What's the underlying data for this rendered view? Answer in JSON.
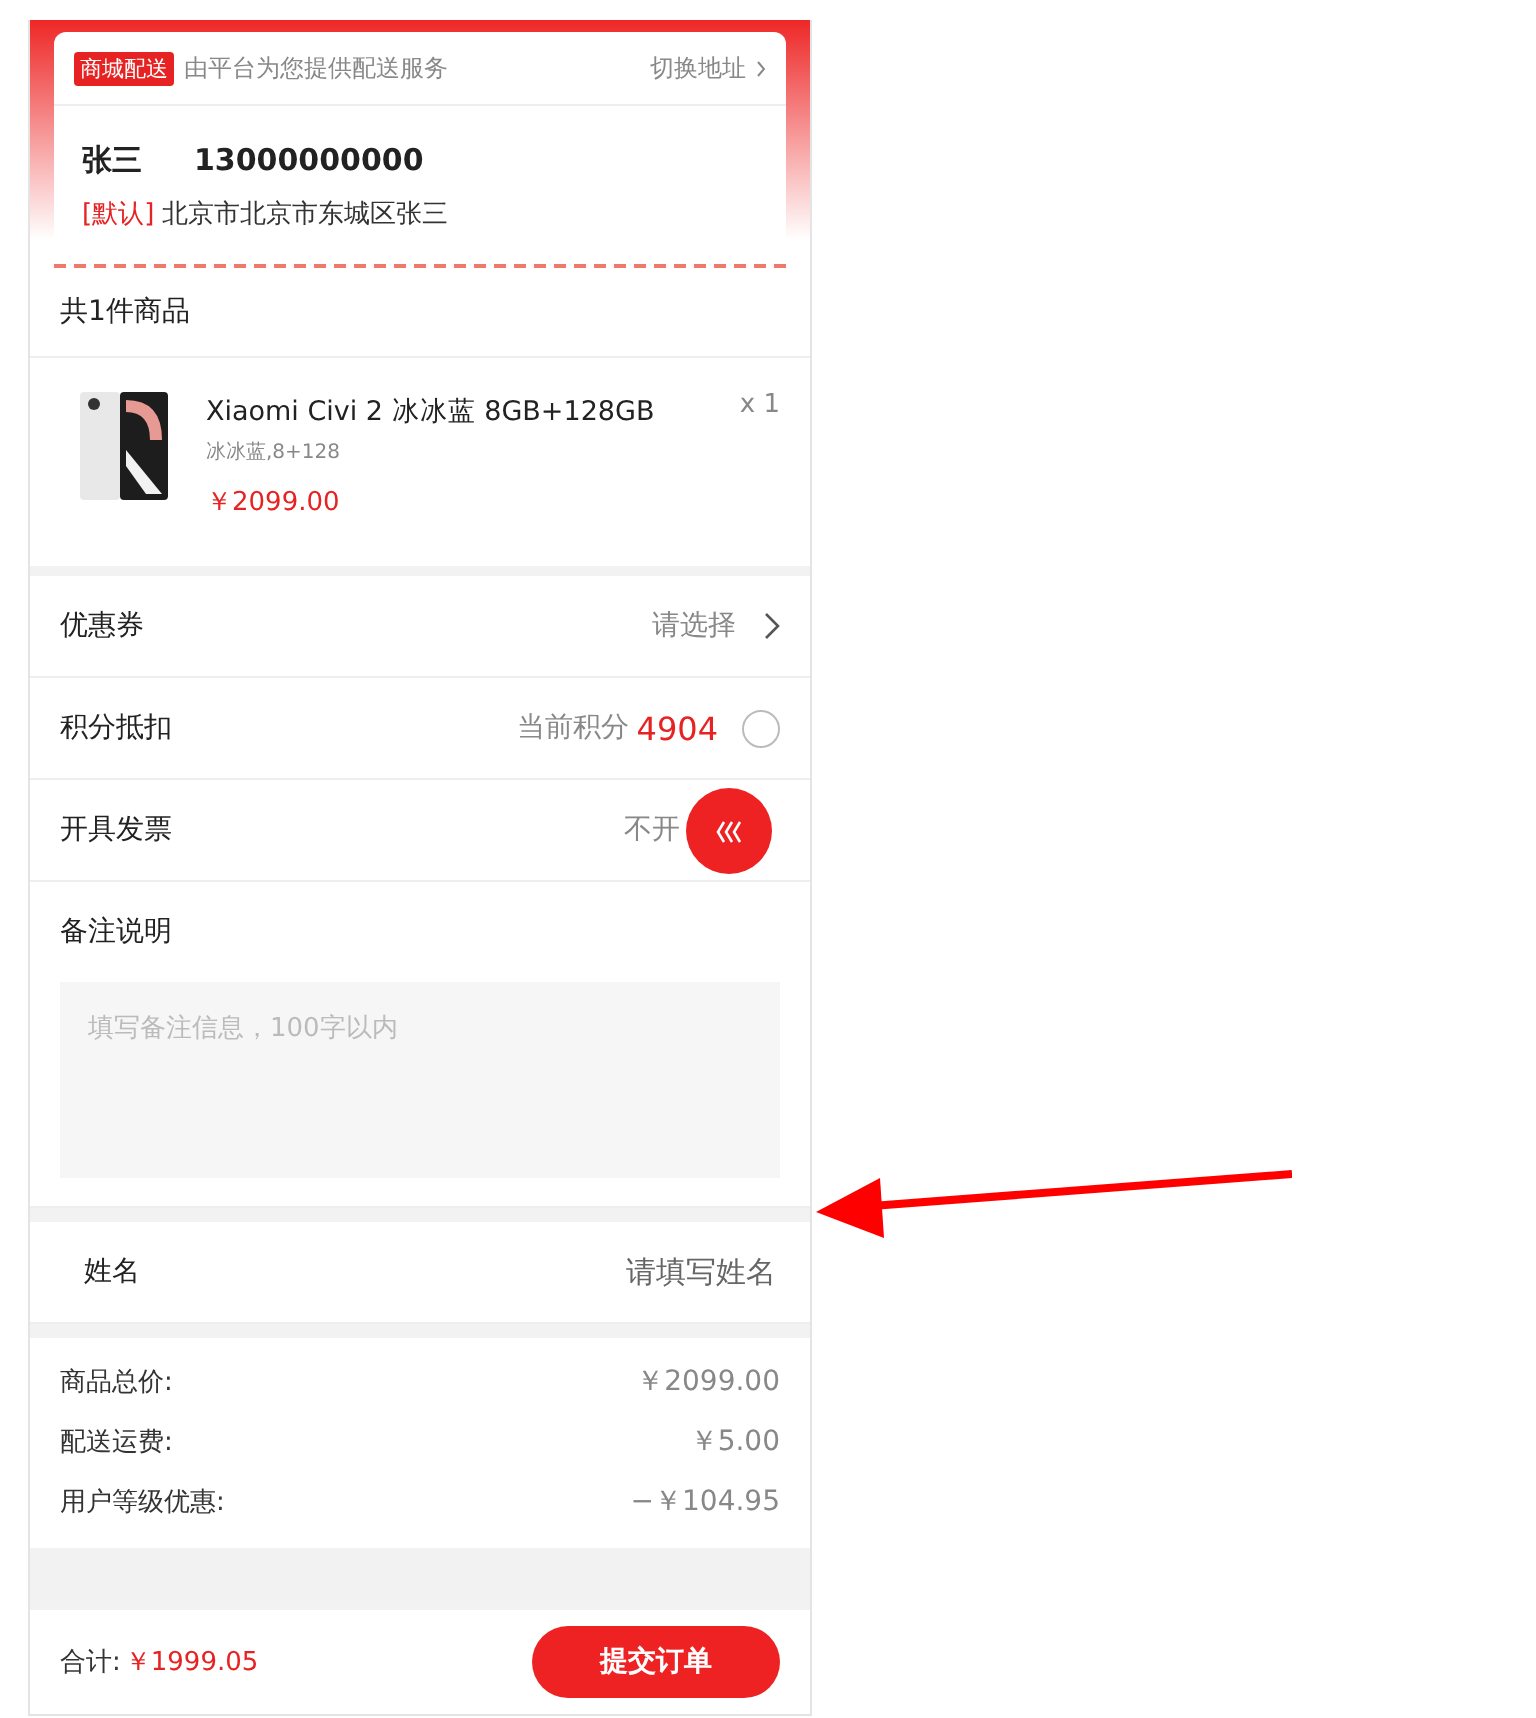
{
  "delivery": {
    "badge": "商城配送",
    "note": "由平台为您提供配送服务",
    "switch_link": "切换地址"
  },
  "address": {
    "name": "张三",
    "phone": "13000000000",
    "default_tag": "[默认]",
    "detail": "北京市北京市东城区张三"
  },
  "items_header": "共1件商品",
  "items": [
    {
      "title": "Xiaomi Civi 2 冰冰蓝 8GB+128GB",
      "spec": "冰冰蓝,8+128",
      "price": "￥2099.00",
      "qty": "x 1"
    }
  ],
  "options": [
    {
      "kind": "link",
      "label": "优惠券",
      "value": "请选择"
    },
    {
      "kind": "toggle",
      "label": "积分抵扣",
      "value": "当前积分",
      "points": "4904",
      "checked": false
    },
    {
      "kind": "plain",
      "label": "开具发票",
      "value": "不开"
    }
  ],
  "remarks": {
    "label": "备注说明",
    "placeholder": "填写备注信息，100字以内"
  },
  "name_field": {
    "label": "姓名",
    "placeholder": "请填写姓名"
  },
  "summary": [
    {
      "label": "商品总价:",
      "value": "￥2099.00"
    },
    {
      "label": "配送运费:",
      "value": "￥5.00"
    },
    {
      "label": "用户等级优惠:",
      "value": "−￥104.95"
    }
  ],
  "footer": {
    "total_label": "合计:",
    "total": "￥1999.05",
    "submit": "提交订单"
  }
}
